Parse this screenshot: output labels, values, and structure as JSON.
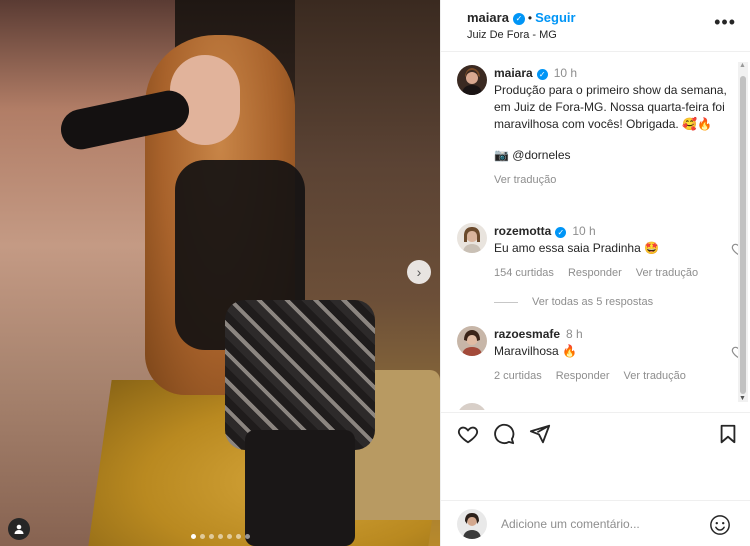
{
  "post": {
    "username": "maiara",
    "follow_label": "Seguir",
    "separator": "•",
    "location": "Juiz De Fora - MG",
    "more_icon": "more-horizontal-icon"
  },
  "caption": {
    "username": "maiara",
    "time": "10 h",
    "text": "Produção para o primeiro show da semana, em Juiz de Fora-MG. Nossa quarta-feira foi maravilhosa com vocês! Obrigada. 🥰🔥",
    "credit": "📷 @dorneles",
    "translate_label": "Ver tradução"
  },
  "comments": [
    {
      "username": "rozemotta",
      "time": "10 h",
      "text": "Eu amo essa saia Pradinha 🤩",
      "likes": "154 curtidas",
      "reply_label": "Responder",
      "translate_label": "Ver tradução"
    },
    {
      "username": "razoesmafe",
      "time": "8 h",
      "text": "Maravilhosa 🔥",
      "likes": "2 curtidas",
      "reply_label": "Responder",
      "translate_label": "Ver tradução"
    }
  ],
  "view_replies_label": "Ver todas as 5 respostas",
  "composer": {
    "placeholder": "Adicione um comentário..."
  },
  "colors": {
    "accent": "#0095f6",
    "verified": "#0095f6",
    "muted": "#8e8e8e",
    "text": "#262626"
  },
  "carousel": {
    "slides": 7,
    "active_index": 0
  }
}
